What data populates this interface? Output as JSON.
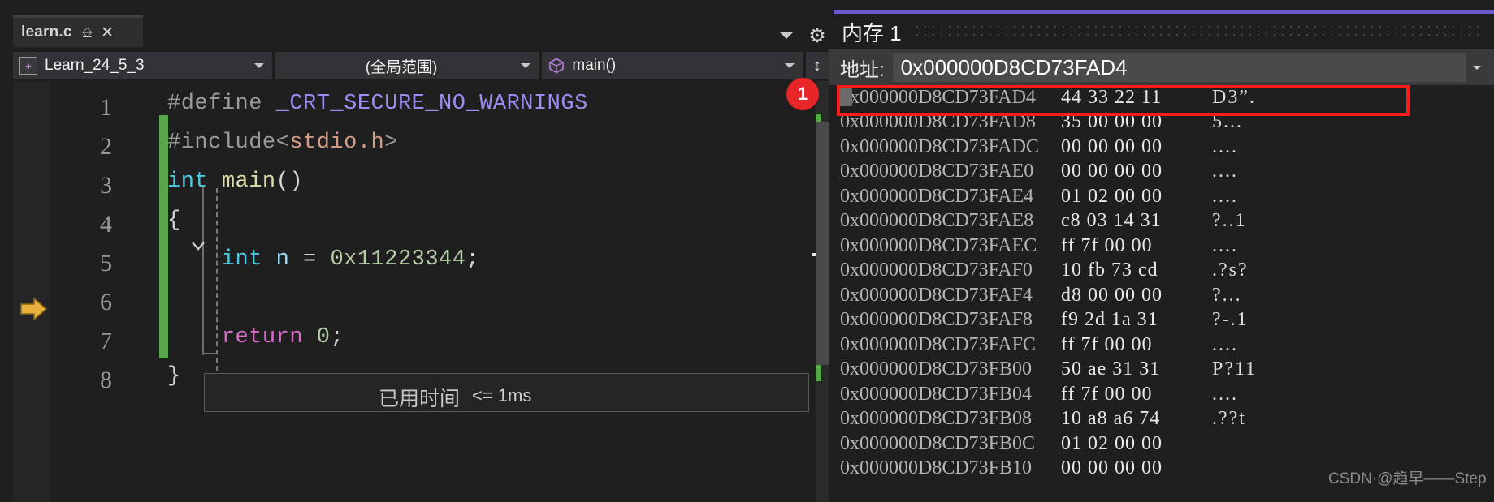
{
  "editor": {
    "tab": {
      "name": "learn.c",
      "pin_icon": "pin-icon",
      "close_icon": "close-icon"
    },
    "tab_overflow_icon": "chevron-down-icon",
    "settings_icon": "gear-icon",
    "nav": {
      "project": "Learn_24_5_3",
      "scope": "(全局范围)",
      "function": "main()",
      "splitter_icon": "split-view-icon"
    },
    "lines": [
      {
        "num": "1",
        "segments": [
          {
            "text": "#define ",
            "color": "#9b9b9b"
          },
          {
            "text": "_CRT_SECURE_NO_WARNINGS",
            "color": "#9b8df0"
          }
        ]
      },
      {
        "num": "2",
        "segments": [
          {
            "text": "#include<",
            "color": "#9b9b9b"
          },
          {
            "text": "stdio.h",
            "color": "#d69d85"
          },
          {
            "text": ">",
            "color": "#9b9b9b"
          }
        ]
      },
      {
        "num": "3",
        "segments": [
          {
            "text": "int ",
            "color": "#4ec9e0"
          },
          {
            "text": "main",
            "color": "#dcdcaa"
          },
          {
            "text": "()",
            "color": "#d4d4d4"
          }
        ]
      },
      {
        "num": "4",
        "segments": [
          {
            "text": "{",
            "color": "#d4d4d4"
          }
        ]
      },
      {
        "num": "5",
        "segments": [
          {
            "text": "    int ",
            "color": "#4ec9e0"
          },
          {
            "text": "n ",
            "color": "#9cdcfe"
          },
          {
            "text": "= ",
            "color": "#d4d4d4"
          },
          {
            "text": "0x11223344",
            "color": "#b5cea8"
          },
          {
            "text": ";",
            "color": "#d4d4d4"
          }
        ]
      },
      {
        "num": "6",
        "segments": []
      },
      {
        "num": "7",
        "segments": [
          {
            "text": "    return ",
            "color": "#d86bc8"
          },
          {
            "text": "0",
            "color": "#b5cea8"
          },
          {
            "text": ";",
            "color": "#d4d4d4"
          }
        ]
      },
      {
        "num": "8",
        "segments": [
          {
            "text": "}",
            "color": "#d4d4d4"
          }
        ]
      }
    ],
    "elapsed": {
      "label": "已用时间",
      "value": "<= 1ms"
    },
    "execution_pointer_icon": "yellow-arrow-icon",
    "badge": "1"
  },
  "memory": {
    "title": "内存 1",
    "address_label": "地址:",
    "address_value": "0x000000D8CD73FAD4",
    "address_caret_icon": "chevron-down-icon",
    "rows": [
      {
        "address": "0x000000D8CD73FAD4",
        "hex": "44 33 22 11",
        "ascii": "D3”."
      },
      {
        "address": "0x000000D8CD73FAD8",
        "hex": "35 00 00 00",
        "ascii": "5..."
      },
      {
        "address": "0x000000D8CD73FADC",
        "hex": "00 00 00 00",
        "ascii": "...."
      },
      {
        "address": "0x000000D8CD73FAE0",
        "hex": "00 00 00 00",
        "ascii": "...."
      },
      {
        "address": "0x000000D8CD73FAE4",
        "hex": "01 02 00 00",
        "ascii": "...."
      },
      {
        "address": "0x000000D8CD73FAE8",
        "hex": "c8 03 14 31",
        "ascii": "?..1"
      },
      {
        "address": "0x000000D8CD73FAEC",
        "hex": "ff 7f 00 00",
        "ascii": "...."
      },
      {
        "address": "0x000000D8CD73FAF0",
        "hex": "10 fb 73 cd",
        "ascii": ".?s?"
      },
      {
        "address": "0x000000D8CD73FAF4",
        "hex": "d8 00 00 00",
        "ascii": "?..."
      },
      {
        "address": "0x000000D8CD73FAF8",
        "hex": "f9 2d 1a 31",
        "ascii": "?-.1"
      },
      {
        "address": "0x000000D8CD73FAFC",
        "hex": "ff 7f 00 00",
        "ascii": "...."
      },
      {
        "address": "0x000000D8CD73FB00",
        "hex": "50 ae 31 31",
        "ascii": "P?11"
      },
      {
        "address": "0x000000D8CD73FB04",
        "hex": "ff 7f 00 00",
        "ascii": "...."
      },
      {
        "address": "0x000000D8CD73FB08",
        "hex": "10 a8 a6 74",
        "ascii": ".??t"
      },
      {
        "address": "0x000000D8CD73FB0C",
        "hex": "01 02 00 00",
        "ascii": ""
      },
      {
        "address": "0x000000D8CD73FB10",
        "hex": "00 00 00 00",
        "ascii": ""
      }
    ]
  },
  "watermark": "CSDN·@趋早——Step",
  "colors": {
    "accent_purple": "#6a5acd",
    "highlight_red": "#ff1a1a",
    "change_green": "#57a64a",
    "badge_red": "#e8262a",
    "arrow_yellow": "#e8b33c"
  }
}
